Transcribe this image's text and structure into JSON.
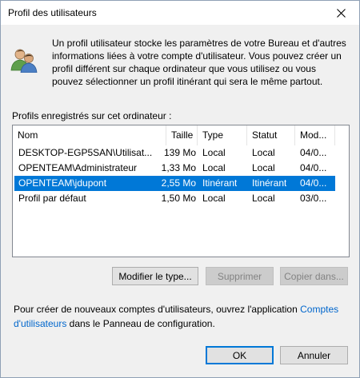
{
  "window": {
    "title": "Profil des utilisateurs"
  },
  "description": "Un profil utilisateur stocke les paramètres de votre Bureau et d'autres informations liées à votre compte d'utilisateur. Vous pouvez créer un profil différent sur chaque ordinateur que vous utilisez ou vous pouvez sélectionner un profil itinérant qui sera le même partout.",
  "list": {
    "label": "Profils enregistrés sur cet ordinateur :",
    "columns": [
      "Nom",
      "Taille",
      "Type",
      "Statut",
      "Mod..."
    ],
    "rows": [
      {
        "name": "DESKTOP-EGP5SAN\\Utilisat...",
        "size": "139 Mo",
        "type": "Local",
        "status": "Local",
        "modified": "04/0...",
        "selected": false
      },
      {
        "name": "OPENTEAM\\Administrateur",
        "size": "1,33 Mo",
        "type": "Local",
        "status": "Local",
        "modified": "04/0...",
        "selected": false
      },
      {
        "name": "OPENTEAM\\jdupont",
        "size": "2,55 Mo",
        "type": "Itinérant",
        "status": "Itinérant",
        "modified": "04/0...",
        "selected": true
      },
      {
        "name": "Profil par défaut",
        "size": "1,50 Mo",
        "type": "Local",
        "status": "Local",
        "modified": "03/0...",
        "selected": false
      }
    ]
  },
  "buttons": {
    "change_type": "Modifier le type...",
    "delete": "Supprimer",
    "copy_to": "Copier dans...",
    "ok": "OK",
    "cancel": "Annuler"
  },
  "footer": {
    "text_before": "Pour créer de nouveaux comptes d'utilisateurs, ouvrez l'application ",
    "link": "Comptes d'utilisateurs",
    "text_after": " dans le Panneau de configuration."
  },
  "colors": {
    "selection": "#0078d7",
    "link": "#0066cc"
  }
}
